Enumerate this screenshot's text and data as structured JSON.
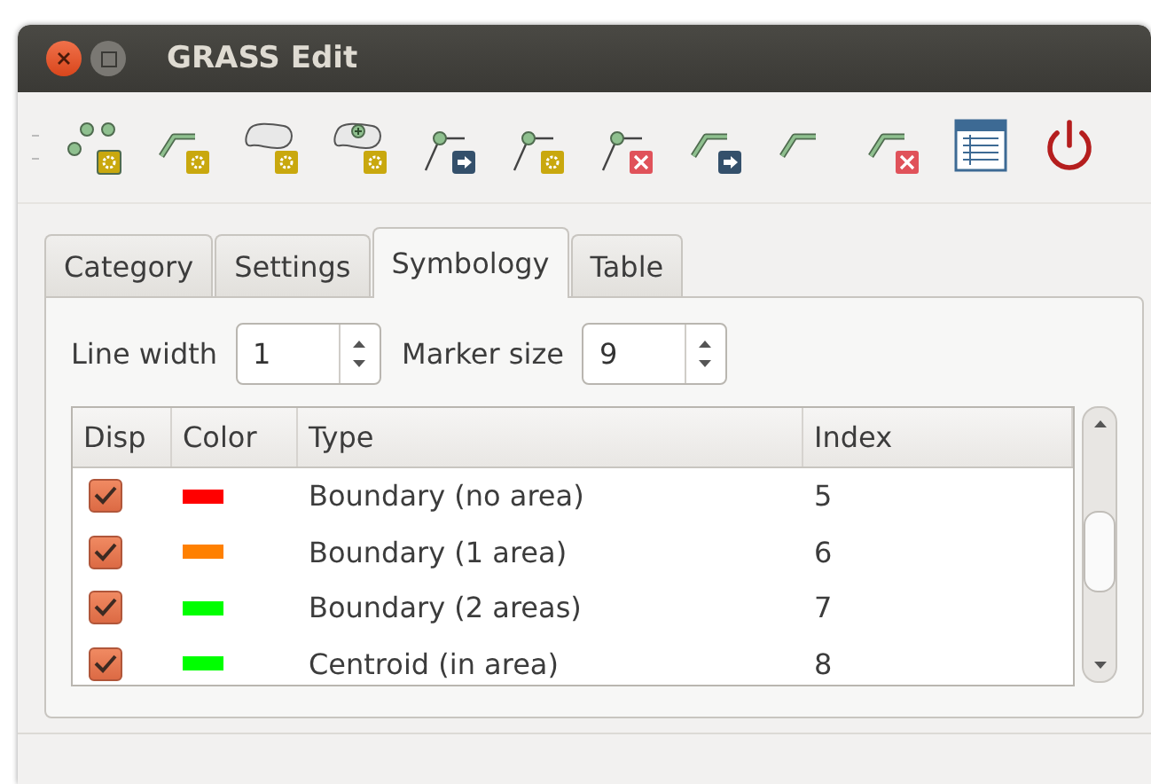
{
  "window": {
    "title": "GRASS Edit"
  },
  "toolbar": [
    {
      "kind": "points-add"
    },
    {
      "kind": "line-add"
    },
    {
      "kind": "area-add"
    },
    {
      "kind": "centroid-add"
    },
    {
      "kind": "vertex-move"
    },
    {
      "kind": "vertex-add"
    },
    {
      "kind": "vertex-delete"
    },
    {
      "kind": "line-move"
    },
    {
      "kind": "line-split"
    },
    {
      "kind": "line-delete"
    },
    {
      "kind": "table"
    },
    {
      "kind": "power"
    }
  ],
  "tabs": [
    {
      "label": "Category",
      "selected": false
    },
    {
      "label": "Settings",
      "selected": false
    },
    {
      "label": "Symbology",
      "selected": true
    },
    {
      "label": "Table",
      "selected": false
    }
  ],
  "line_width": {
    "label": "Line width",
    "value": "1"
  },
  "marker_size": {
    "label": "Marker size",
    "value": "9"
  },
  "table": {
    "columns": [
      "Disp",
      "Color",
      "Type",
      "Index"
    ],
    "rows": [
      {
        "checked": true,
        "color": "#ff0000",
        "type": "Boundary (no area)",
        "index": "5"
      },
      {
        "checked": true,
        "color": "#ff8000",
        "type": "Boundary (1 area)",
        "index": "6"
      },
      {
        "checked": true,
        "color": "#00ff00",
        "type": "Boundary (2 areas)",
        "index": "7"
      },
      {
        "checked": true,
        "color": "#00ff00",
        "type": "Centroid (in area)",
        "index": "8"
      }
    ]
  }
}
